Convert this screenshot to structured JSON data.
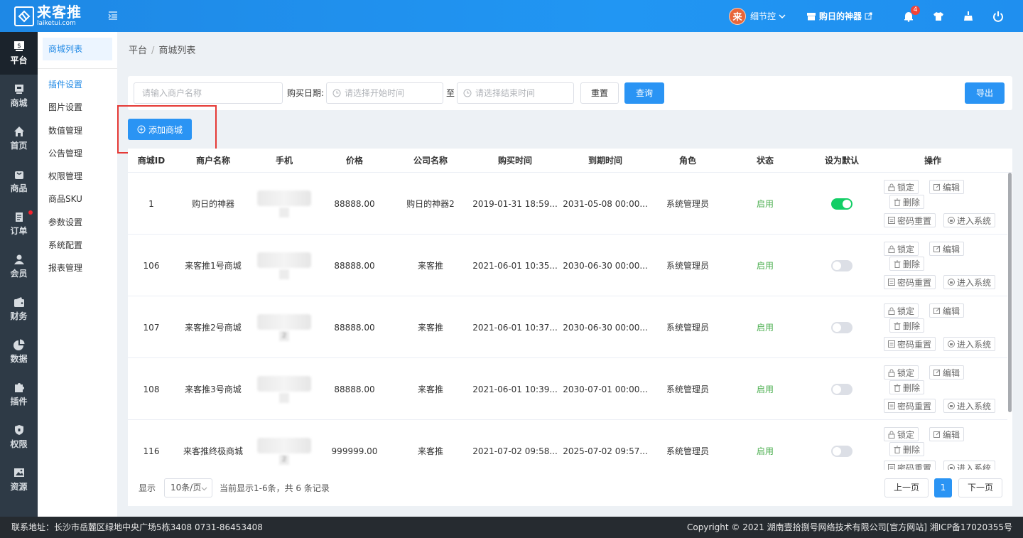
{
  "header": {
    "logo_text": "来客推",
    "logo_domain": "laiketui.com",
    "user_name": "细节控",
    "avatar_char": "来",
    "store_name": "购日的神器",
    "notification_count": "4"
  },
  "nav": [
    {
      "label": "平台",
      "icon": "dollar-icon",
      "active": true
    },
    {
      "label": "商城",
      "icon": "shop-icon"
    },
    {
      "label": "首页",
      "icon": "home-icon"
    },
    {
      "label": "商品",
      "icon": "bag-icon"
    },
    {
      "label": "订单",
      "icon": "order-icon",
      "dot": true
    },
    {
      "label": "会员",
      "icon": "user-icon"
    },
    {
      "label": "财务",
      "icon": "wallet-icon"
    },
    {
      "label": "数据",
      "icon": "pie-chart-icon"
    },
    {
      "label": "插件",
      "icon": "puzzle-icon"
    },
    {
      "label": "权限",
      "icon": "shield-icon"
    },
    {
      "label": "资源",
      "icon": "image-icon"
    }
  ],
  "subnav": {
    "header": "商城列表",
    "items": [
      "插件设置",
      "图片设置",
      "数值管理",
      "公告管理",
      "权限管理",
      "商品SKU",
      "参数设置",
      "系统配置",
      "报表管理"
    ]
  },
  "breadcrumb": {
    "root": "平台",
    "current": "商城列表"
  },
  "search": {
    "merchant_placeholder": "请输入商户名称",
    "date_label": "购买日期:",
    "start_placeholder": "请选择开始时间",
    "to_label": "至",
    "end_placeholder": "请选择结束时间",
    "reset_label": "重置",
    "query_label": "查询",
    "export_label": "导出"
  },
  "add_button": "添加商城",
  "table": {
    "headers": [
      "商城ID",
      "商户名称",
      "手机",
      "价格",
      "公司名称",
      "购买时间",
      "到期时间",
      "角色",
      "状态",
      "设为默认",
      "操作"
    ],
    "rows": [
      {
        "id": "1",
        "name": "购日的神器",
        "phone_tail": "",
        "price": "88888.00",
        "company": "购日的神器2",
        "buy_time": "2019-01-31 18:59...",
        "expire_time": "2031-05-08 00:00...",
        "role": "系统管理员",
        "status": "启用",
        "default": true
      },
      {
        "id": "106",
        "name": "来客推1号商城",
        "phone_tail": "",
        "price": "88888.00",
        "company": "来客推",
        "buy_time": "2021-06-01 10:35...",
        "expire_time": "2030-06-30 00:00...",
        "role": "系统管理员",
        "status": "启用",
        "default": false
      },
      {
        "id": "107",
        "name": "来客推2号商城",
        "phone_tail": "2",
        "price": "88888.00",
        "company": "来客推",
        "buy_time": "2021-06-01 10:37...",
        "expire_time": "2030-06-30 00:00...",
        "role": "系统管理员",
        "status": "启用",
        "default": false
      },
      {
        "id": "108",
        "name": "来客推3号商城",
        "phone_tail": "",
        "price": "88888.00",
        "company": "来客推",
        "buy_time": "2021-06-01 10:39...",
        "expire_time": "2030-07-01 00:00...",
        "role": "系统管理员",
        "status": "启用",
        "default": false
      },
      {
        "id": "116",
        "name": "来客推终极商城",
        "phone_tail": "2",
        "price": "999999.00",
        "company": "来客推",
        "buy_time": "2021-07-02 09:58...",
        "expire_time": "2025-07-02 09:57...",
        "role": "系统管理员",
        "status": "启用",
        "default": false
      }
    ],
    "actions": {
      "lock": "锁定",
      "edit": "编辑",
      "delete": "删除",
      "reset_pwd": "密码重置",
      "enter": "进入系统"
    }
  },
  "pagination": {
    "show_label": "显示",
    "page_size": "10条/页",
    "summary": "当前显示1-6条，共 6 条记录",
    "prev": "上一页",
    "current": "1",
    "next": "下一页"
  },
  "footer": {
    "address": "联系地址：长沙市岳麓区绿地中央广场5栋3408 0731-86453408",
    "copyright": "Copyright © 2021 湖南壹拾捌号网络技术有限公司[官方网站]   湘ICP备17020355号"
  },
  "colors": {
    "primary": "#2a94f4",
    "header": "#1e88e5",
    "sidebar": "#2e3a46",
    "success": "#4caf50",
    "highlight": "#e53935"
  }
}
